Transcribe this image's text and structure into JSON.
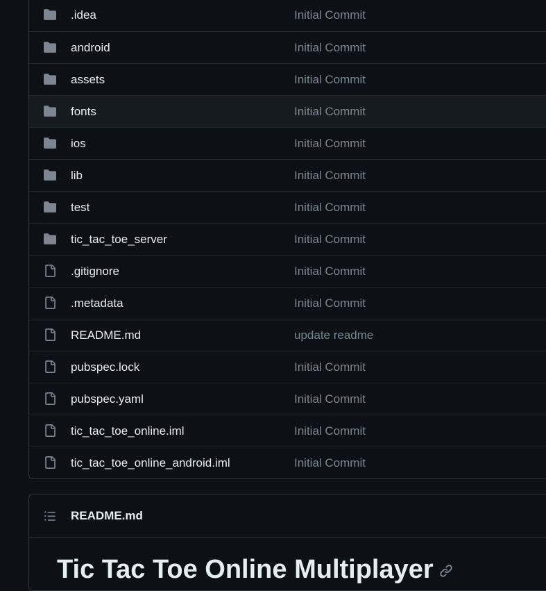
{
  "files": [
    {
      "name": ".idea",
      "type": "folder",
      "icon": "folder-icon",
      "commit": "Initial Commit"
    },
    {
      "name": "android",
      "type": "folder",
      "icon": "folder-icon",
      "commit": "Initial Commit"
    },
    {
      "name": "assets",
      "type": "folder",
      "icon": "folder-icon",
      "commit": "Initial Commit"
    },
    {
      "name": "fonts",
      "type": "folder",
      "icon": "folder-icon",
      "commit": "Initial Commit"
    },
    {
      "name": "ios",
      "type": "folder",
      "icon": "folder-icon",
      "commit": "Initial Commit"
    },
    {
      "name": "lib",
      "type": "folder",
      "icon": "folder-icon",
      "commit": "Initial Commit"
    },
    {
      "name": "test",
      "type": "folder",
      "icon": "folder-icon",
      "commit": "Initial Commit"
    },
    {
      "name": "tic_tac_toe_server",
      "type": "folder",
      "icon": "folder-icon",
      "commit": "Initial Commit"
    },
    {
      "name": ".gitignore",
      "type": "file",
      "icon": "file-icon",
      "commit": "Initial Commit"
    },
    {
      "name": ".metadata",
      "type": "file",
      "icon": "file-icon",
      "commit": "Initial Commit"
    },
    {
      "name": "README.md",
      "type": "file",
      "icon": "file-icon",
      "commit": "update readme"
    },
    {
      "name": "pubspec.lock",
      "type": "file",
      "icon": "file-icon",
      "commit": "Initial Commit"
    },
    {
      "name": "pubspec.yaml",
      "type": "file",
      "icon": "file-icon",
      "commit": "Initial Commit"
    },
    {
      "name": "tic_tac_toe_online.iml",
      "type": "file",
      "icon": "file-icon",
      "commit": "Initial Commit"
    },
    {
      "name": "tic_tac_toe_online_android.iml",
      "type": "file",
      "icon": "file-icon",
      "commit": "Initial Commit"
    }
  ],
  "readme": {
    "header_title": "README.md",
    "header_icon": "list-unordered-icon",
    "heading": "Tic Tac Toe Online Multiplayer",
    "anchor_icon": "link-icon"
  },
  "colors": {
    "background": "#0d1117",
    "hover_row": "#161b22",
    "border": "#30363d",
    "text": "#e6edf3",
    "muted": "#7d8590",
    "icon": "#7d8590"
  }
}
